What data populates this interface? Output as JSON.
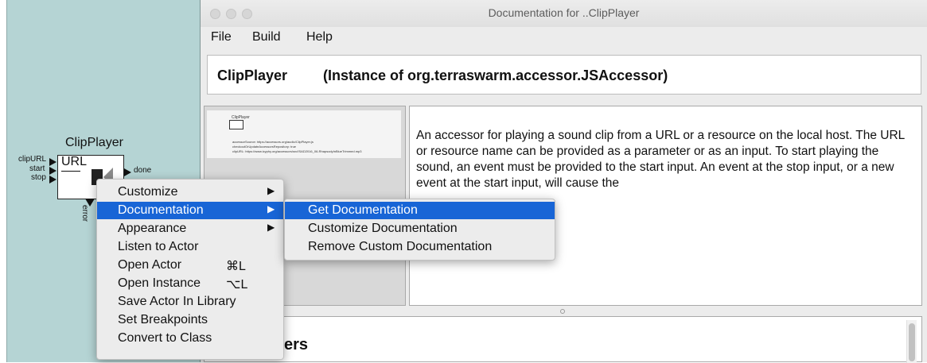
{
  "canvas": {
    "actor": {
      "title": "ClipPlayer",
      "url_label": "URL",
      "inputs": [
        "clipURL",
        "start",
        "stop"
      ],
      "outputs": [
        "done",
        "error"
      ]
    }
  },
  "window": {
    "title": "Documentation for ..ClipPlayer",
    "menu": [
      "File",
      "Build",
      "Help"
    ],
    "header": {
      "name": "ClipPlayer",
      "instance": "(Instance of org.terraswarm.accessor.JSAccessor)"
    },
    "thumbnail": {
      "title": "ClipPlayer",
      "line1": "accessorSource: https://accessors.org/audio/ClipPlayer.js",
      "line2": "checkoutOrUpdateAccessorsRepository: true",
      "line3": "clipURL: https://www.icyphy.org/accessors/src/ISAD2016_06-RhapsodyInBlueTrimmed.mp3"
    },
    "description": "An accessor for playing a sound clip from a URL or a resource on the local host. The URL or resource name can be provided as a parameter or as an input. To start playing the sound, an event must be provided to the start input. An event at the stop input, or a new event at the start input, will cause the",
    "bottom_partial_heading": "ers"
  },
  "context_menu": {
    "items": [
      {
        "label": "Customize",
        "arrow": "▶",
        "shortcut": ""
      },
      {
        "label": "Documentation",
        "arrow": "▶",
        "shortcut": ""
      },
      {
        "label": "Appearance",
        "arrow": "▶",
        "shortcut": ""
      },
      {
        "label": "Listen to Actor",
        "arrow": "",
        "shortcut": ""
      },
      {
        "label": "Open Actor",
        "arrow": "",
        "shortcut": "⌘L"
      },
      {
        "label": "Open Instance",
        "arrow": "",
        "shortcut": "⌥L"
      },
      {
        "label": "Save Actor In Library",
        "arrow": "",
        "shortcut": ""
      },
      {
        "label": "Set Breakpoints",
        "arrow": "",
        "shortcut": ""
      },
      {
        "label": "Convert to Class",
        "arrow": "",
        "shortcut": ""
      }
    ],
    "selected": "Documentation"
  },
  "submenu": {
    "items": [
      "Get Documentation",
      "Customize Documentation",
      "Remove Custom Documentation"
    ],
    "selected": "Get Documentation"
  },
  "colors": {
    "selection": "#1865d6",
    "canvas_bg": "#b5d4d4"
  }
}
